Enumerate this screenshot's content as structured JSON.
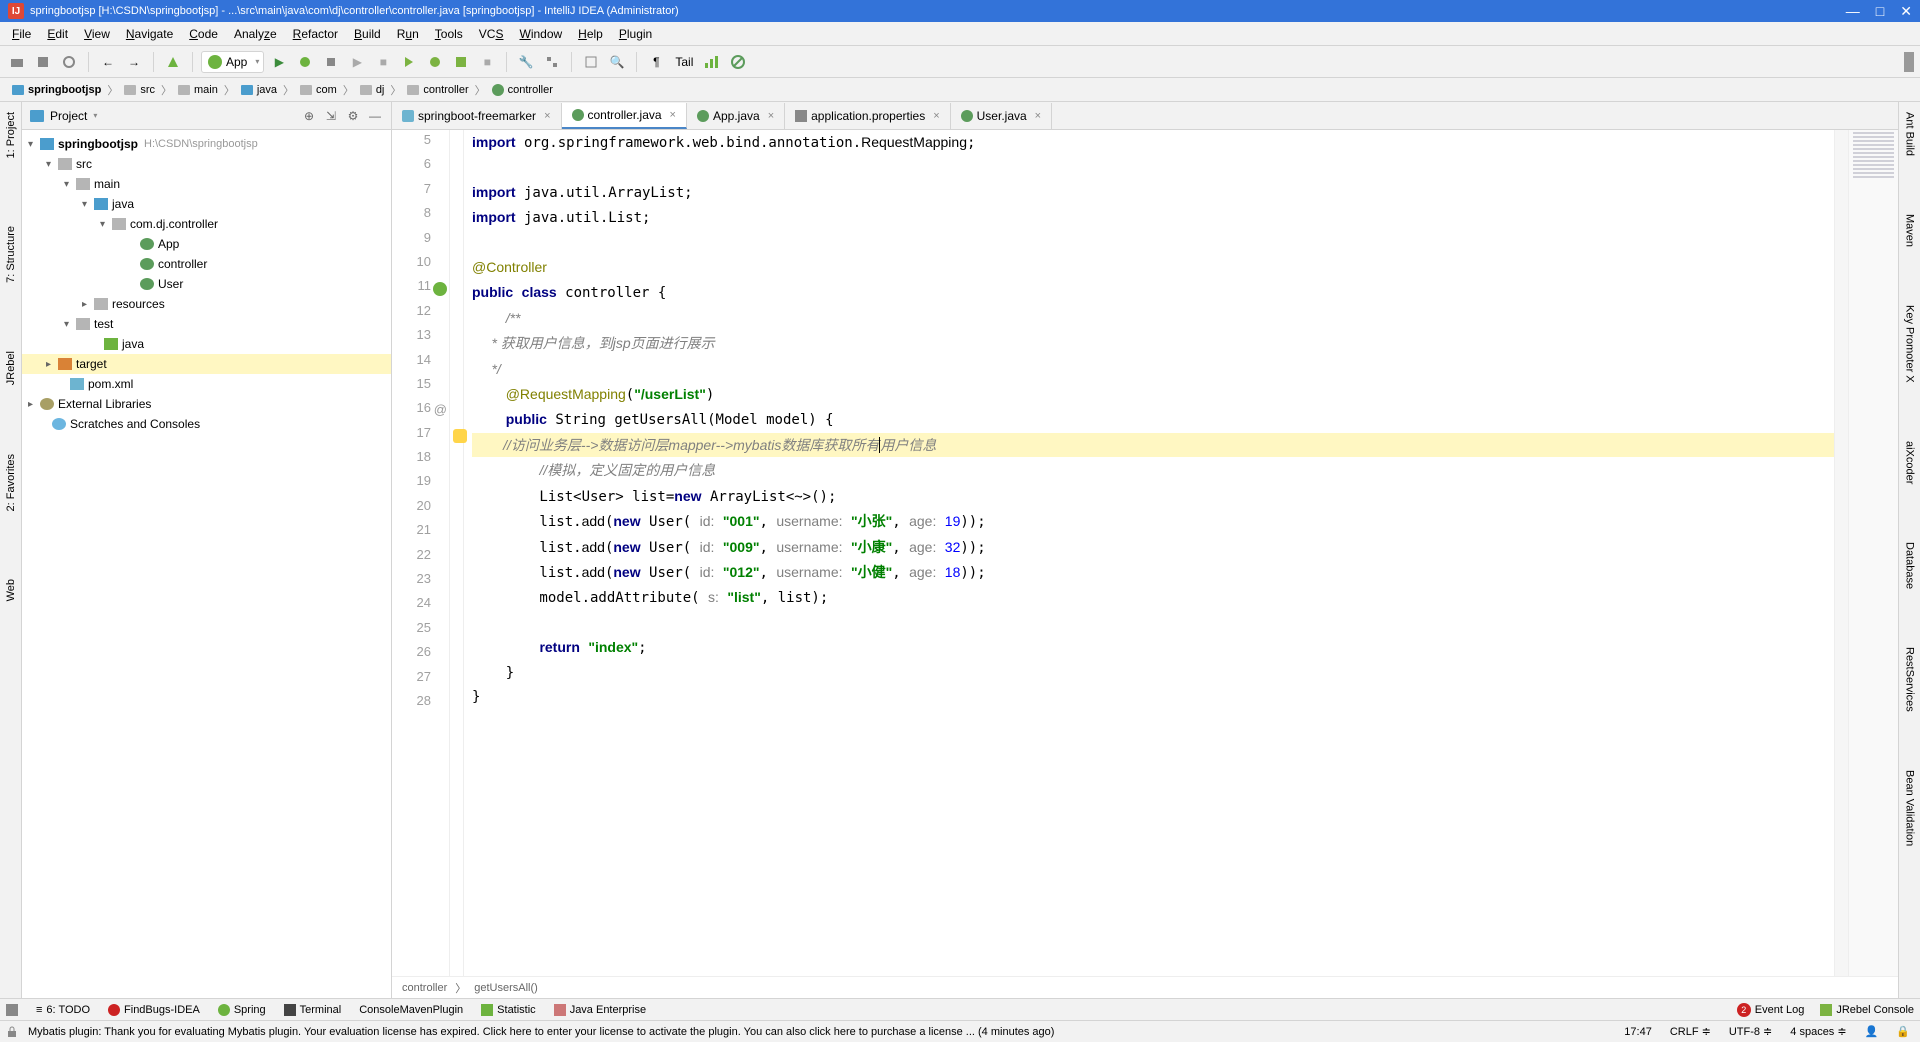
{
  "title": "springbootjsp [H:\\CSDN\\springbootjsp] - ...\\src\\main\\java\\com\\dj\\controller\\controller.java [springbootjsp] - IntelliJ IDEA (Administrator)",
  "menu": [
    "File",
    "Edit",
    "View",
    "Navigate",
    "Code",
    "Analyze",
    "Refactor",
    "Build",
    "Run",
    "Tools",
    "VCS",
    "Window",
    "Help",
    "Plugin"
  ],
  "run_config": "App",
  "tail_label": "Tail",
  "breadcrumb": [
    "springbootjsp",
    "src",
    "main",
    "java",
    "com",
    "dj",
    "controller",
    "controller"
  ],
  "project_panel_title": "Project",
  "tree": {
    "root": {
      "name": "springbootjsp",
      "path": "H:\\CSDN\\springbootjsp"
    },
    "src": "src",
    "main": "main",
    "java": "java",
    "pkg": "com.dj.controller",
    "classes": [
      "App",
      "controller",
      "User"
    ],
    "resources": "resources",
    "test": "test",
    "test_java": "java",
    "target": "target",
    "pom": "pom.xml",
    "ext": "External Libraries",
    "scratch": "Scratches and Consoles"
  },
  "editor_tabs": [
    {
      "name": "springboot-freemarker",
      "icon": "m"
    },
    {
      "name": "controller.java",
      "icon": "c",
      "active": true
    },
    {
      "name": "App.java",
      "icon": "c"
    },
    {
      "name": "application.properties",
      "icon": "p"
    },
    {
      "name": "User.java",
      "icon": "c"
    }
  ],
  "code_lines": {
    "start": 5,
    "end": 28
  },
  "editor_breadcrumb": [
    "controller",
    "getUsersAll()"
  ],
  "left_tabs": [
    "1: Project",
    "7: Structure",
    "JRebel",
    "2: Favorites",
    "Web"
  ],
  "right_tabs": [
    "Ant Build",
    "Maven",
    "Key Promoter X",
    "aiXcoder",
    "Database",
    "RestServices",
    "Bean Validation"
  ],
  "bottom_tabs": [
    "6: TODO",
    "FindBugs-IDEA",
    "Spring",
    "Terminal",
    "ConsoleMavenPlugin",
    "Statistic",
    "Java Enterprise"
  ],
  "bottom_right": [
    "Event Log",
    "JRebel Console"
  ],
  "event_count": "2",
  "status": {
    "msg": "Mybatis plugin: Thank you for evaluating Mybatis plugin. Your evaluation license has expired. Click here to enter your license to activate the plugin. You can also click here to purchase a license ... (4 minutes ago)",
    "time": "17:47",
    "lineend": "CRLF",
    "encoding": "UTF-8",
    "indent": "4 spaces"
  }
}
